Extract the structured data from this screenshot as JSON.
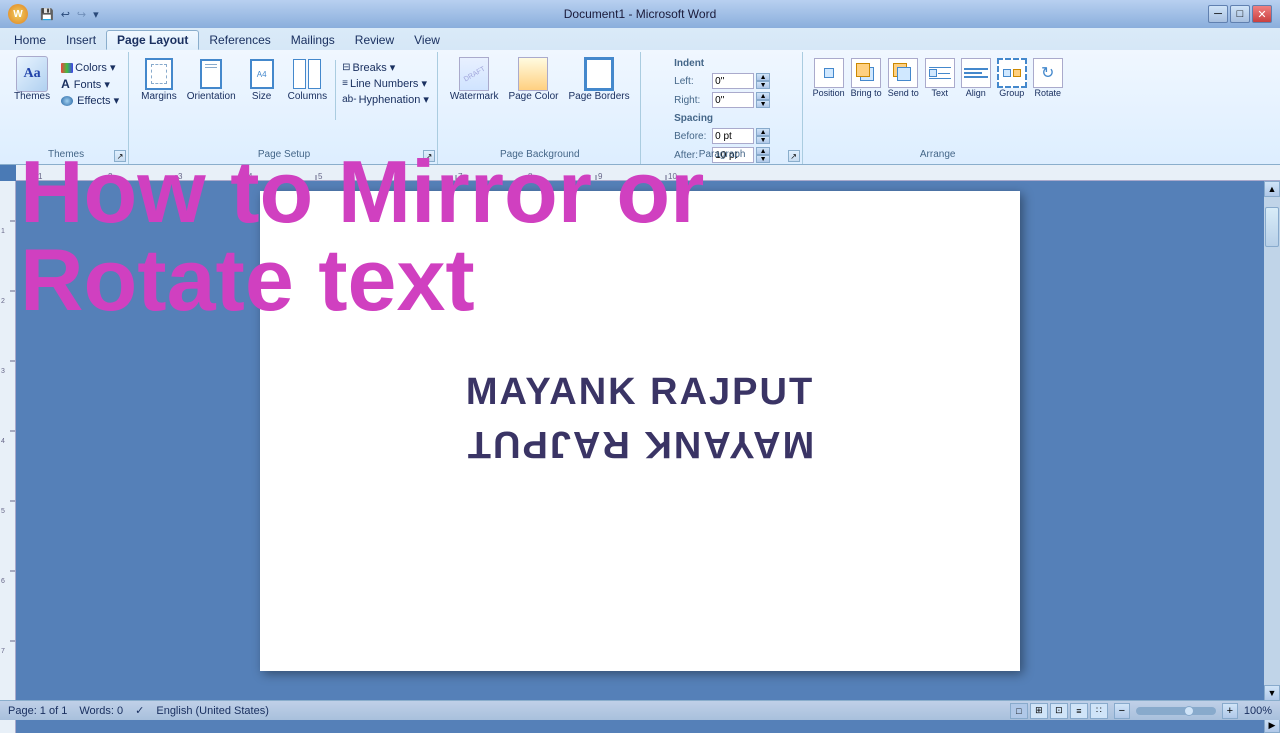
{
  "titlebar": {
    "title": "Document1 - Microsoft Word",
    "quicksave": "💾",
    "undo": "↩",
    "redo": "↪",
    "dropdown": "▾"
  },
  "tabs": [
    {
      "label": "Home",
      "active": false
    },
    {
      "label": "Insert",
      "active": false
    },
    {
      "label": "Page Layout",
      "active": true
    },
    {
      "label": "References",
      "active": false
    },
    {
      "label": "Mailings",
      "active": false
    },
    {
      "label": "Review",
      "active": false
    },
    {
      "label": "View",
      "active": false
    }
  ],
  "ribbon": {
    "groups": [
      {
        "name": "Themes",
        "buttons": [
          {
            "label": "Themes",
            "type": "large"
          },
          {
            "label": "Colors ▾",
            "type": "small"
          },
          {
            "label": "Fonts ▾",
            "type": "small"
          },
          {
            "label": "Effects ▾",
            "type": "small"
          }
        ]
      },
      {
        "name": "Page Setup",
        "buttons": [
          {
            "label": "Margins",
            "type": "large"
          },
          {
            "label": "Orientation",
            "type": "large"
          },
          {
            "label": "Size",
            "type": "large"
          },
          {
            "label": "Columns",
            "type": "large"
          }
        ],
        "small_buttons": [
          {
            "label": "Breaks ▾"
          },
          {
            "label": "Line Numbers ▾"
          },
          {
            "label": "Hyphenation ▾"
          }
        ]
      },
      {
        "name": "Page Background",
        "buttons": [
          {
            "label": "Watermark",
            "type": "large"
          },
          {
            "label": "Page Color",
            "type": "large"
          },
          {
            "label": "Page Borders",
            "type": "large"
          }
        ]
      },
      {
        "name": "Paragraph",
        "indent_left_label": "Left:",
        "indent_left_value": "0\"",
        "indent_right_label": "Right:",
        "indent_right_value": "0\"",
        "spacing_before_label": "Before:",
        "spacing_before_value": "0 pt",
        "spacing_after_label": "After:",
        "spacing_after_value": "10 pt"
      },
      {
        "name": "Arrange",
        "buttons": [
          {
            "label": "Position"
          },
          {
            "label": "Bring to Front"
          },
          {
            "label": "Send to Back"
          },
          {
            "label": "Text Wrapping"
          },
          {
            "label": "Align"
          },
          {
            "label": "Group"
          },
          {
            "label": "Rotate"
          }
        ]
      }
    ]
  },
  "overlay": {
    "line1": "How  to  Mirror  or",
    "line2": "Rotate  text"
  },
  "document": {
    "name_normal": "MAYANK RAJPUT",
    "name_mirrored": "ꓤUꓒꓤAЯ ꓘNAYAM"
  },
  "statusbar": {
    "page": "Page: 1 of 1",
    "words": "Words: 0",
    "language": "English (United States)",
    "zoom": "100%"
  }
}
